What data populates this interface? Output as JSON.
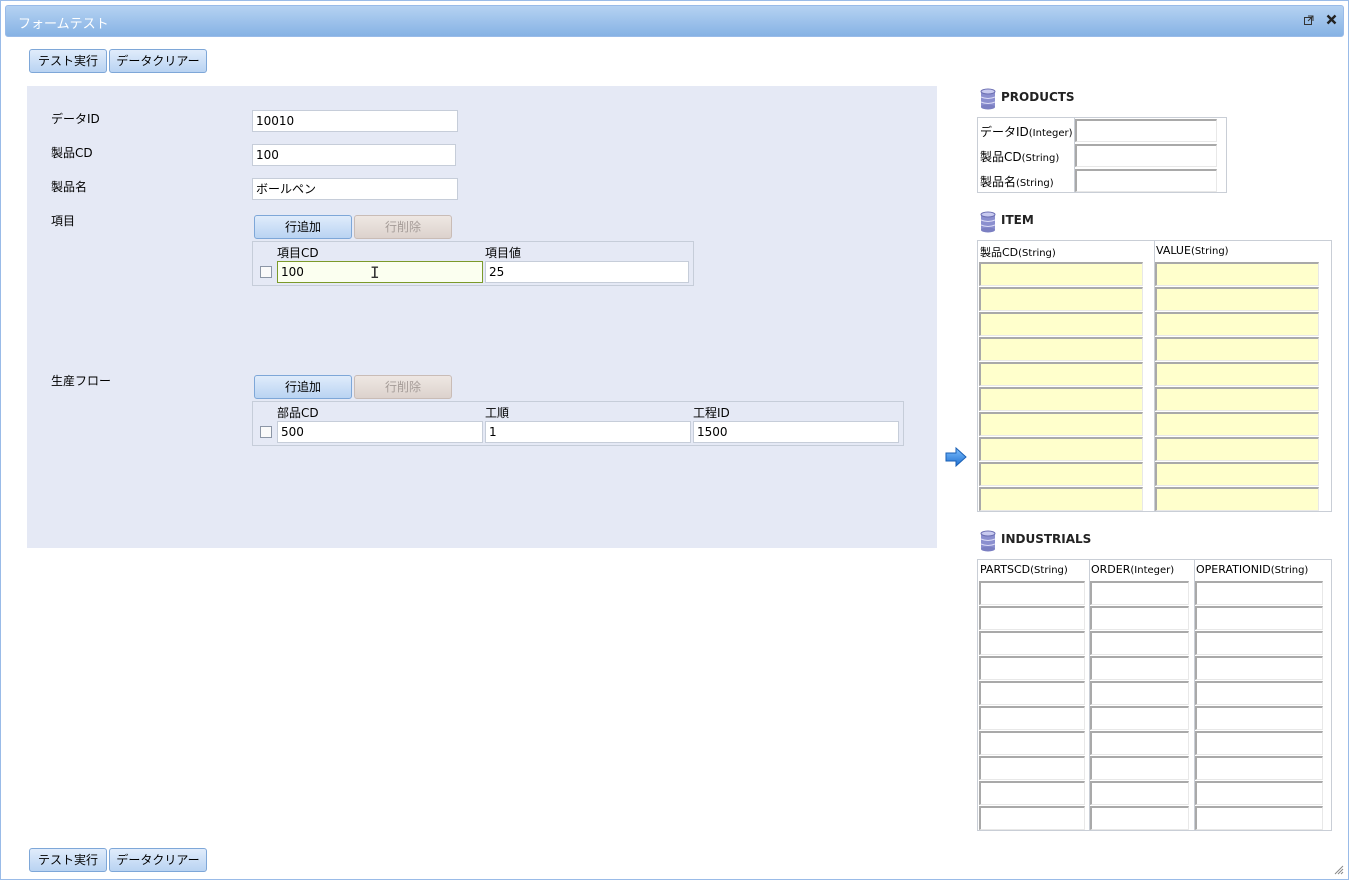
{
  "window": {
    "title": "フォームテスト",
    "popout_icon": "popout-icon",
    "close_icon": "close-icon"
  },
  "toolbar_top": {
    "run_label": "テスト実行",
    "clear_label": "データクリアー"
  },
  "toolbar_bottom": {
    "run_label": "テスト実行",
    "clear_label": "データクリアー"
  },
  "form": {
    "data_id": {
      "label": "データID",
      "value": "10010"
    },
    "product_cd": {
      "label": "製品CD",
      "value": "100"
    },
    "product_name": {
      "label": "製品名",
      "value": "ボールペン"
    },
    "items": {
      "label": "項目",
      "add_label": "行追加",
      "delete_label": "行削除",
      "columns": [
        "項目CD",
        "項目値"
      ],
      "rows": [
        [
          "100",
          "25"
        ]
      ]
    },
    "flow": {
      "label": "生産フロー",
      "add_label": "行追加",
      "delete_label": "行削除",
      "columns": [
        "部品CD",
        "工順",
        "工程ID"
      ],
      "rows": [
        [
          "500",
          "1",
          "1500"
        ]
      ]
    }
  },
  "products": {
    "title": "PRODUCTS",
    "icon": "database-icon",
    "fields": [
      {
        "name": "データID",
        "type": "(Integer)",
        "value": ""
      },
      {
        "name": "製品CD",
        "type": "(String)",
        "value": ""
      },
      {
        "name": "製品名",
        "type": "(String)",
        "value": ""
      }
    ]
  },
  "item": {
    "title": "ITEM",
    "icon": "database-icon",
    "columns": [
      {
        "name": "製品CD",
        "type": "(String)"
      },
      {
        "name": "VALUE",
        "type": "(String)"
      }
    ],
    "row_count": 10
  },
  "industrials": {
    "title": "INDUSTRIALS",
    "icon": "database-icon",
    "columns": [
      {
        "name": "PARTSCD",
        "type": "(String)"
      },
      {
        "name": "ORDER",
        "type": "(Integer)"
      },
      {
        "name": "OPERATIONID",
        "type": "(String)"
      }
    ],
    "row_count": 10
  },
  "transfer_icon": "arrow-right-icon",
  "colors": {
    "title_bar": "#99bbe8",
    "form_bg": "#e5e9f5",
    "cell_yellow": "#ffffcc"
  }
}
